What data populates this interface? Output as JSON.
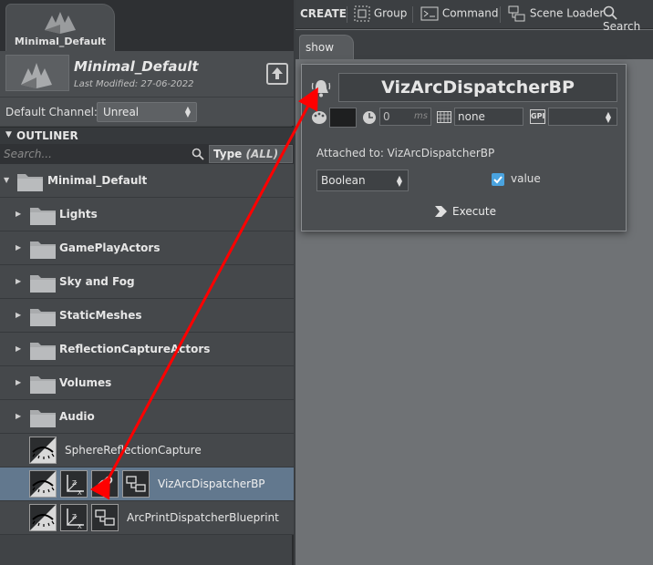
{
  "project": {
    "tab_label": "Minimal_Default",
    "name": "Minimal_Default",
    "last_modified": "Last Modified: 27-06-2022"
  },
  "channel": {
    "label": "Default Channel:",
    "value": "Unreal"
  },
  "outliner": {
    "title": "OUTLINER",
    "search_placeholder": "Search...",
    "type_filter_label": "Type",
    "type_filter_value": "(ALL)",
    "root": "Minimal_Default",
    "folders": [
      "Lights",
      "GamePlayActors",
      "Sky and Fog",
      "StaticMeshes",
      "ReflectionCaptureActors",
      "Volumes",
      "Audio"
    ],
    "objects": [
      "SphereReflectionCapture",
      "VizArcDispatcherBP",
      "ArcPrintDispatcherBlueprint"
    ]
  },
  "toolbar": {
    "create": "CREATE",
    "group": "Group",
    "command": "Command",
    "scene_loader": "Scene Loader",
    "search": "Search"
  },
  "show_tab": "show",
  "popup": {
    "title": "VizArcDispatcherBP",
    "delay_value": "0",
    "delay_unit": "ms",
    "grid_value": "none",
    "gpi_label": "GPI",
    "attached": "Attached to:  VizArcDispatcherBP",
    "type": "Boolean",
    "value_label": "value",
    "execute": "Execute"
  },
  "colors": {
    "selection": "#62788e",
    "checkbox": "#4aa3df",
    "arrow": "#ff0000"
  }
}
